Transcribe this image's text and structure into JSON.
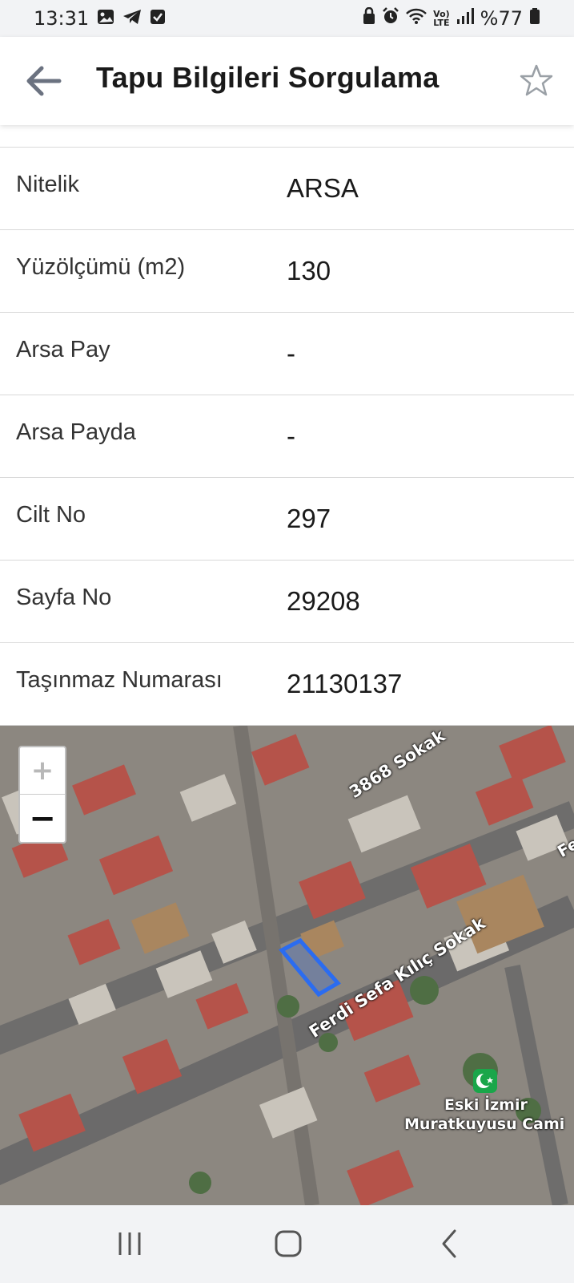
{
  "status_bar": {
    "time": "13:31",
    "battery": "%77",
    "network": "LTE",
    "left_icons": [
      "gallery-icon",
      "telegram-icon",
      "checkbox-icon"
    ],
    "right_icons": [
      "lock-icon",
      "alarm-icon",
      "wifi-icon",
      "volte-icon",
      "signal-icon",
      "battery-icon"
    ]
  },
  "app_bar": {
    "title": "Tapu Bilgileri Sorgulama",
    "back_icon": "arrow-left-icon",
    "favorite_icon": "star-outline-icon"
  },
  "details": [
    {
      "label": "Nitelik",
      "value": "ARSA"
    },
    {
      "label": "Yüzölçümü (m2)",
      "value": "130"
    },
    {
      "label": "Arsa Pay",
      "value": "-"
    },
    {
      "label": "Arsa Payda",
      "value": "-"
    },
    {
      "label": "Cilt No",
      "value": "297"
    },
    {
      "label": "Sayfa No",
      "value": "29208"
    },
    {
      "label": "Taşınmaz Numarası",
      "value": "21130137"
    }
  ],
  "map": {
    "zoom_in": "+",
    "zoom_out": "−",
    "street_1": "3868 Sokak",
    "street_2": "Ferdi Sefa Kılıç Sokak",
    "street_3": "Fe",
    "poi_line_1": "Eski İzmir",
    "poi_line_2": "Muratkuyusu Cami",
    "parcel_color": "#2b6cf0",
    "poi_color": "#1aa64a"
  },
  "nav_bar": {
    "recents_icon": "recents-icon",
    "home_icon": "home-icon",
    "back_icon": "back-chevron-icon"
  }
}
